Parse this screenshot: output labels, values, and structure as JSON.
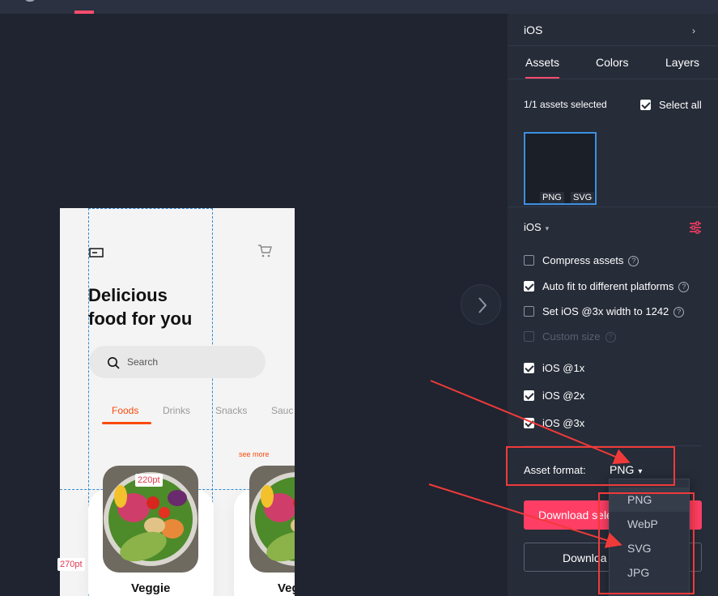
{
  "colors": {
    "accent": "#ff3e66",
    "food_accent": "#fa4a0c",
    "annotation_red": "#f03a3a",
    "selection_blue": "#3d8fe0"
  },
  "canvas": {
    "nav_next_icon": "chevron-right-icon",
    "phone": {
      "headline_line1": "Delicious",
      "headline_line2": "food for you",
      "search_placeholder": "Search",
      "categories": [
        "Foods",
        "Drinks",
        "Snacks",
        "Sauc"
      ],
      "active_category": "Foods",
      "see_more": "see more",
      "cards": [
        {
          "title": "Veggie"
        },
        {
          "title": "Veg"
        }
      ],
      "measure_width": "220pt",
      "measure_height": "270pt"
    }
  },
  "panel": {
    "platform_header": "iOS",
    "tabs": [
      {
        "label": "Assets",
        "active": true
      },
      {
        "label": "Colors",
        "active": false
      },
      {
        "label": "Layers",
        "active": false
      }
    ],
    "assets_selected": "1/1 assets selected",
    "select_all_label": "Select all",
    "select_all_checked": true,
    "thumbnail_formats": [
      "PNG",
      "SVG"
    ],
    "platform_select": "iOS",
    "options": [
      {
        "label": "Compress assets",
        "checked": false,
        "help": true,
        "disabled": false
      },
      {
        "label": "Auto fit to different platforms",
        "checked": true,
        "help": true,
        "disabled": false
      },
      {
        "label": "Set iOS @3x width to 1242",
        "checked": false,
        "help": true,
        "disabled": false
      },
      {
        "label": "Custom size",
        "checked": false,
        "help": true,
        "disabled": true
      }
    ],
    "scales": [
      {
        "label": "iOS @1x",
        "checked": true
      },
      {
        "label": "iOS @2x",
        "checked": true
      },
      {
        "label": "iOS @3x",
        "checked": true
      }
    ],
    "asset_format_label": "Asset format:",
    "asset_format_value": "PNG",
    "download_selected_label": "Download sele",
    "download_label": "Downloa"
  },
  "dropdown": {
    "options": [
      "PNG",
      "WebP",
      "SVG",
      "JPG"
    ],
    "selected": "PNG"
  }
}
